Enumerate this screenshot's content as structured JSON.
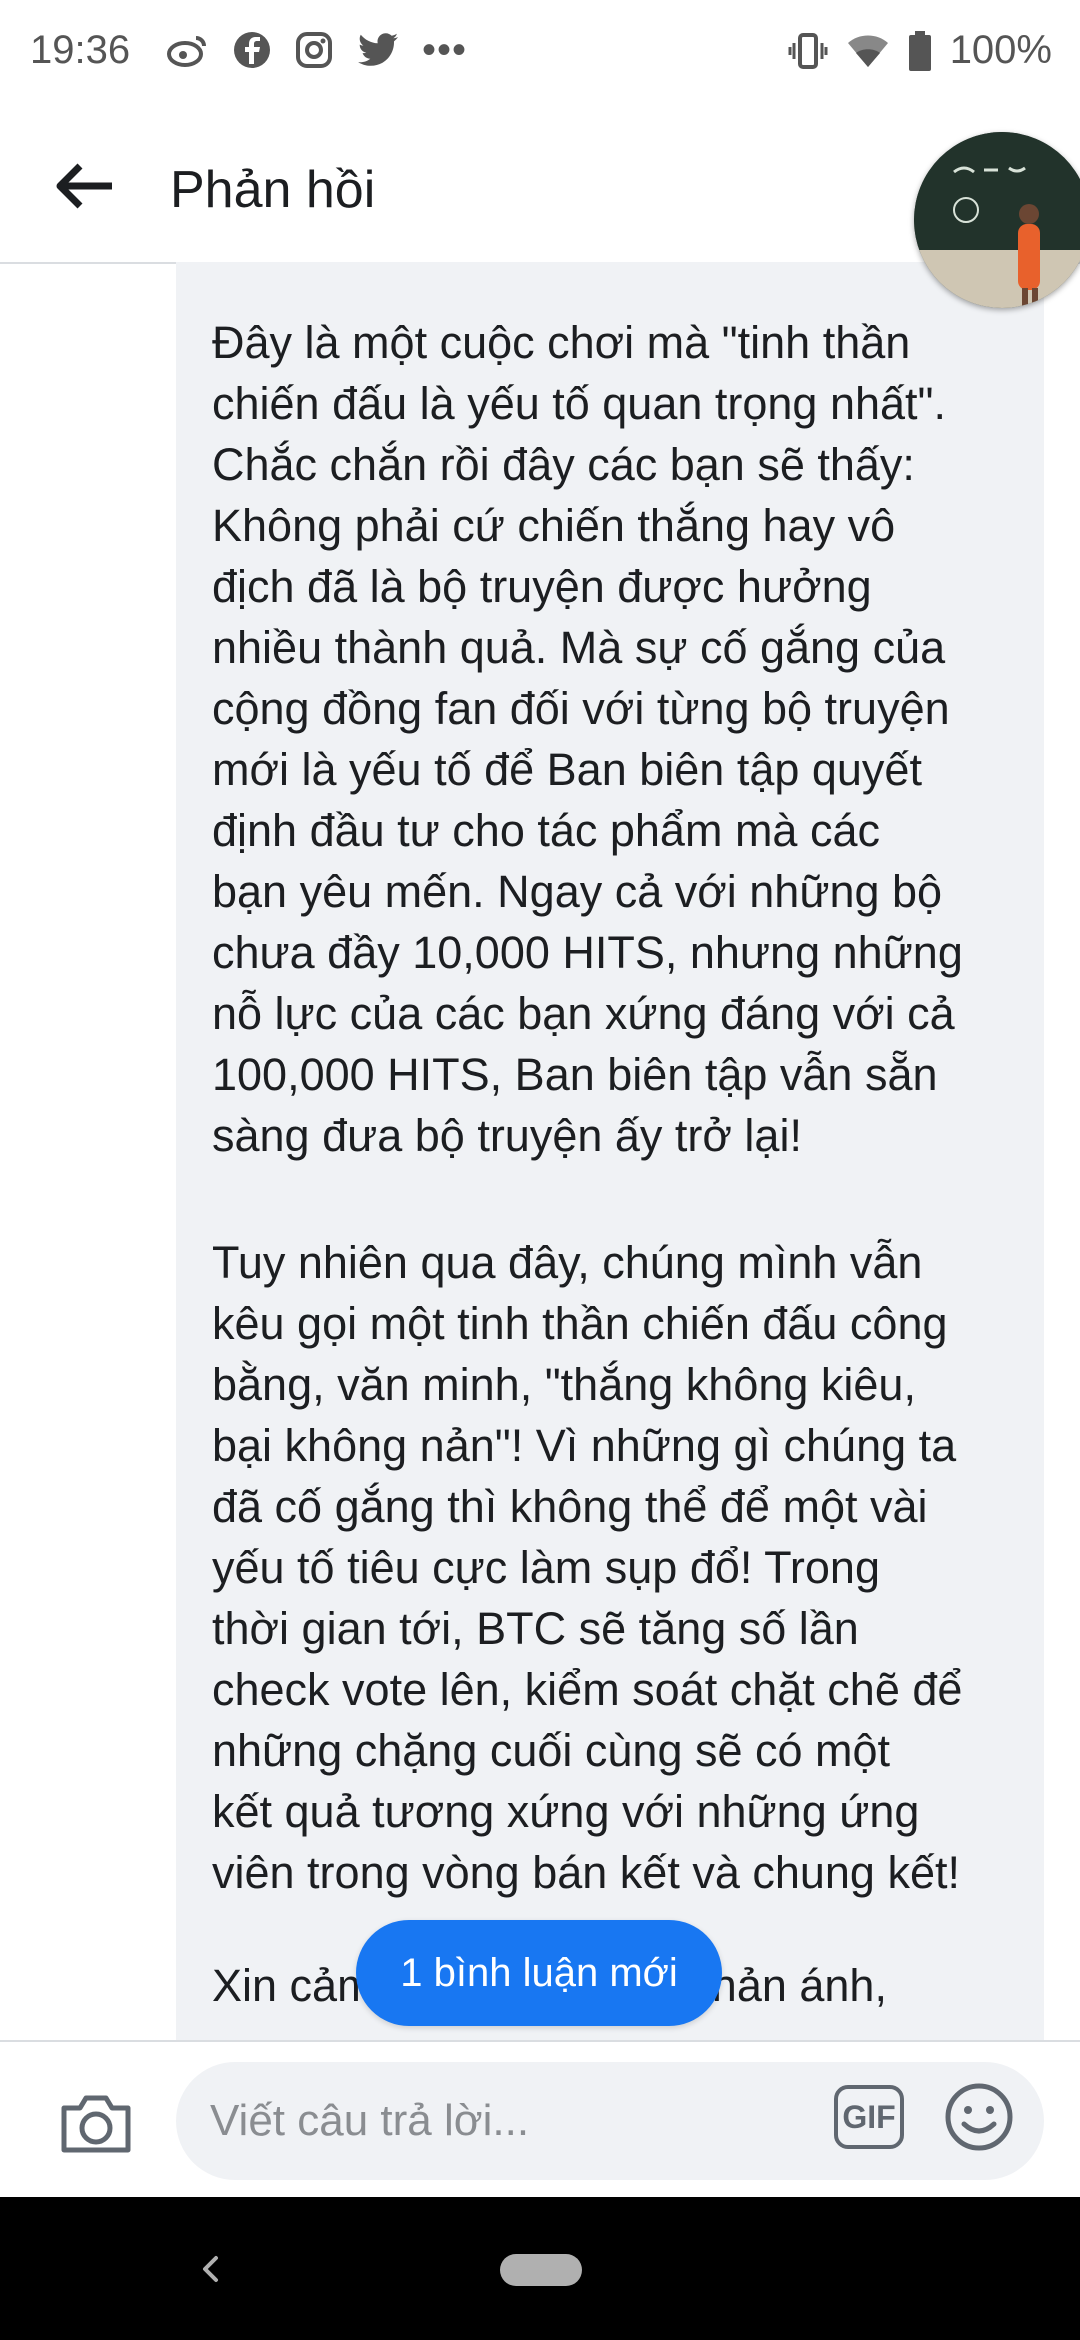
{
  "status_bar": {
    "time": "19:36",
    "left_icons": [
      "weibo-icon",
      "facebook-icon",
      "instagram-icon",
      "twitter-icon"
    ],
    "more": "•••",
    "battery": "100%"
  },
  "header": {
    "title": "Phản hồi"
  },
  "comment": {
    "paragraphs": [
      "Đây là một cuộc chơi mà \"tinh thần\nchiến đấu là yếu tố quan trọng nhất\".\nChắc chắn rồi đây các bạn sẽ thấy:\nKhông phải cứ chiến thắng hay vô\nđịch đã là bộ truyện được hưởng\nnhiều thành quả. Mà sự cố gắng của\ncộng đồng fan đối với từng bộ truyện\nmới là yếu tố để Ban biên tập quyết\nđịnh đầu tư cho tác phẩm mà các\nbạn yêu mến. Ngay cả với những bộ\nchưa đầy 10,000 HITS, nhưng những\nnỗ lực của các bạn xứng đáng với cả\n100,000 HITS, Ban biên tập vẫn sẵn\nsàng đưa bộ truyện ấy trở lại!",
      "Tuy nhiên qua đây, chúng mình vẫn\nkêu gọi một tinh thần chiến đấu công\nbằng, văn minh, \"thắng không kiêu,\nbại không nản\"! Vì những gì chúng ta\nđã cố gắng thì không thể để một vài\nyếu tố tiêu cực làm sụp đổ! Trong\nthời gian tới, BTC sẽ tăng số lần\ncheck vote lên, kiểm soát chặt chẽ để\nnhững chặng cuối cùng sẽ có một\nkết quả tương xứng với những ứng\nviên trong vòng bán kết và chung kết!",
      "Xin cảm ơn các bạn đã phản ánh,"
    ]
  },
  "new_comments_pill": "1 bình luận mới",
  "composer": {
    "placeholder": "Viết câu trả lời...",
    "gif_label": "GIF"
  },
  "colors": {
    "accent": "#1877f2",
    "bubble_bg": "#f0f2f5",
    "text": "#1c1e21"
  }
}
